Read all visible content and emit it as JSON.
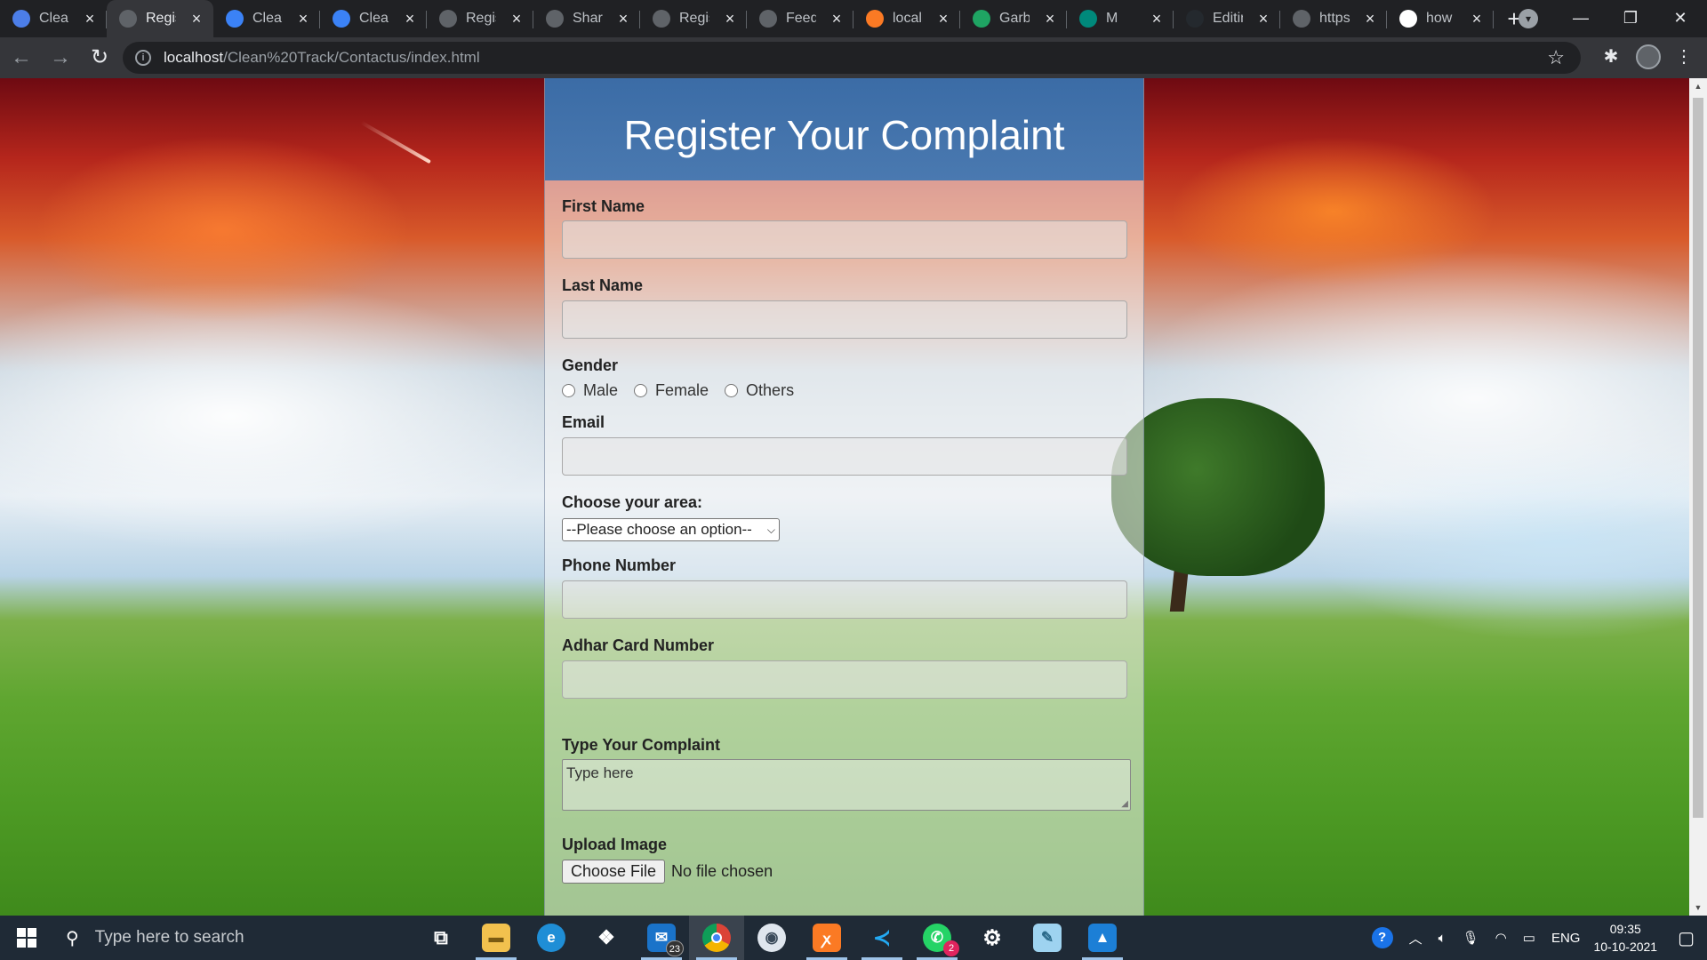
{
  "browser": {
    "tabs": [
      {
        "title": "Clean Track",
        "favicon": "globe-blue",
        "color": "#4c7ee8"
      },
      {
        "title": "Register",
        "favicon": "globe",
        "color": "#5f6368",
        "active": true
      },
      {
        "title": "Clean Track",
        "favicon": "slash",
        "color": "#3b82f6"
      },
      {
        "title": "Clean Track",
        "favicon": "slash",
        "color": "#3b82f6"
      },
      {
        "title": "Register",
        "favicon": "globe",
        "color": "#5f6368"
      },
      {
        "title": "Share",
        "favicon": "globe",
        "color": "#5f6368"
      },
      {
        "title": "Register",
        "favicon": "globe",
        "color": "#5f6368"
      },
      {
        "title": "Feedback",
        "favicon": "globe",
        "color": "#5f6368"
      },
      {
        "title": "localhost",
        "favicon": "xampp",
        "color": "#fb7a24"
      },
      {
        "title": "Garbage",
        "favicon": "drive",
        "color": "#1fa463"
      },
      {
        "title": "M",
        "favicon": "meet",
        "color": "#00897b"
      },
      {
        "title": "Editing",
        "favicon": "github",
        "color": "#24292e"
      },
      {
        "title": "https",
        "favicon": "globe",
        "color": "#5f6368"
      },
      {
        "title": "how",
        "favicon": "google",
        "color": "#ffffff"
      }
    ],
    "new_tab_label": "+",
    "url_host": "localhost",
    "url_path": "/Clean%20Track/Contactus/index.html"
  },
  "form": {
    "title": "Register Your Complaint",
    "first_name_label": "First Name",
    "last_name_label": "Last Name",
    "gender_label": "Gender",
    "gender_options": [
      "Male",
      "Female",
      "Others"
    ],
    "email_label": "Email",
    "area_label": "Choose your area:",
    "area_selected": "--Please choose an option--",
    "phone_label": "Phone Number",
    "adhar_label": "Adhar Card Number",
    "complaint_label": "Type Your Complaint",
    "complaint_placeholder": "Type here",
    "upload_label": "Upload Image",
    "choose_file_label": "Choose File",
    "no_file_text": "No file chosen"
  },
  "taskbar": {
    "search_placeholder": "Type here to search",
    "mail_badge": "23",
    "whatsapp_badge": "2",
    "language": "ENG",
    "time": "09:35",
    "date": "10-10-2021"
  }
}
